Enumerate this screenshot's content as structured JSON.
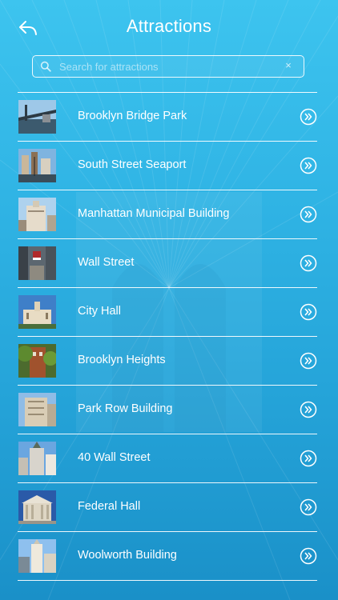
{
  "header": {
    "title": "Attractions",
    "back_icon": "reply-back-icon"
  },
  "search": {
    "placeholder": "Search for attractions",
    "value": "",
    "icon": "search-icon",
    "clear_icon": "clear-icon",
    "clear_glyph": "×"
  },
  "attractions": [
    {
      "label": "Brooklyn Bridge Park"
    },
    {
      "label": "South Street Seaport"
    },
    {
      "label": "Manhattan Municipal Building"
    },
    {
      "label": "Wall Street"
    },
    {
      "label": "City Hall"
    },
    {
      "label": "Brooklyn Heights"
    },
    {
      "label": "Park Row Building"
    },
    {
      "label": "40 Wall Street"
    },
    {
      "label": "Federal Hall"
    },
    {
      "label": "Woolworth Building"
    }
  ],
  "row_icon": "chevron-right-circle-icon",
  "colors": {
    "background_top": "#3dc4ef",
    "background_bottom": "#1a90c8",
    "text": "#ffffff",
    "divider": "#ffffff"
  }
}
